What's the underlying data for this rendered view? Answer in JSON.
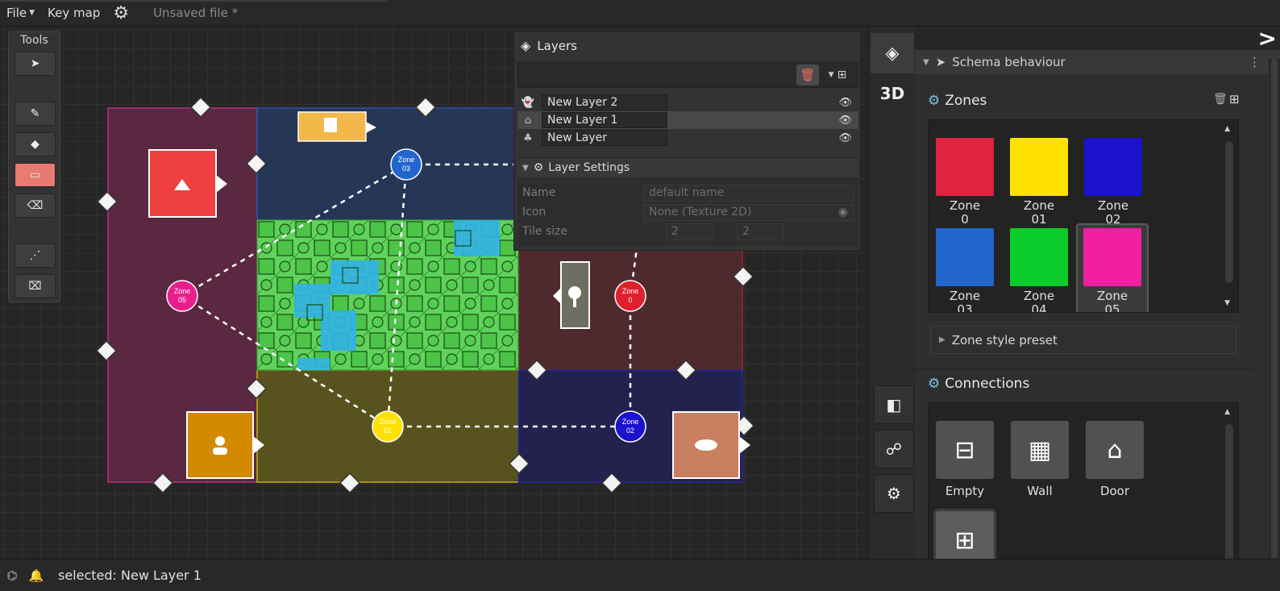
{
  "menubar": {
    "file_label": "File",
    "keymap_label": "Key map",
    "settings_icon": "gear-icon",
    "file_title": "Unsaved file *"
  },
  "tools": {
    "title": "Tools",
    "items": [
      "select-arrow-icon",
      "paint-brush-icon",
      "fill-bucket-icon",
      "rectangle-icon",
      "eraser-icon",
      "connection-icon",
      "erase-connection-icon"
    ],
    "active_color": "#e87a72"
  },
  "map": {
    "zones": [
      {
        "label": "Zone\n05",
        "color": "#e91e8c"
      },
      {
        "label": "Zone\n03",
        "color": "#2266cc"
      },
      {
        "label": "Zone\n01",
        "color": "#ffe100"
      },
      {
        "label": "Zone\n0",
        "color": "#e0202c"
      },
      {
        "label": "Zone\n02",
        "color": "#1a12cc"
      }
    ],
    "zone_names": [
      "Zone 05",
      "Zone 03",
      "Zone 01",
      "Zone 0",
      "Zone 02"
    ]
  },
  "layers": {
    "title": "Layers",
    "items": [
      {
        "name": "New Layer 2",
        "icon": "ghost-icon",
        "selected": false
      },
      {
        "name": "New Layer 1",
        "icon": "house-icon",
        "selected": true
      },
      {
        "name": "New Layer",
        "icon": "tree-icon",
        "selected": false
      }
    ],
    "settings": {
      "title": "Layer Settings",
      "name_label": "Name",
      "name_placeholder": "default name",
      "icon_label": "Icon",
      "icon_value": "None (Texture 2D)",
      "tile_label": "Tile size",
      "tile_x": "2",
      "tile_y": "2"
    }
  },
  "inspector": {
    "schema_title": "Schema behaviour",
    "zones_title": "Zones",
    "zone_swatches": [
      {
        "label_top": "Zone",
        "label_bottom": "0",
        "color": "#e0233f"
      },
      {
        "label_top": "Zone",
        "label_bottom": "01",
        "color": "#ffe100"
      },
      {
        "label_top": "Zone",
        "label_bottom": "02",
        "color": "#1a12cc"
      },
      {
        "label_top": "Zone",
        "label_bottom": "03",
        "color": "#2266cc"
      },
      {
        "label_top": "Zone",
        "label_bottom": "04",
        "color": "#0ccc2c"
      },
      {
        "label_top": "Zone",
        "label_bottom": "05",
        "color": "#f020a0"
      }
    ],
    "zone_style_preset": "Zone style preset",
    "connections_title": "Connections",
    "connections": [
      {
        "label": "Empty",
        "icon": "minus-box-icon"
      },
      {
        "label": "Wall",
        "icon": "bricks-icon"
      },
      {
        "label": "Door",
        "icon": "door-icon"
      },
      {
        "label": "",
        "icon": "gate-icon"
      }
    ]
  },
  "status": {
    "text": "selected: New Layer 1"
  }
}
